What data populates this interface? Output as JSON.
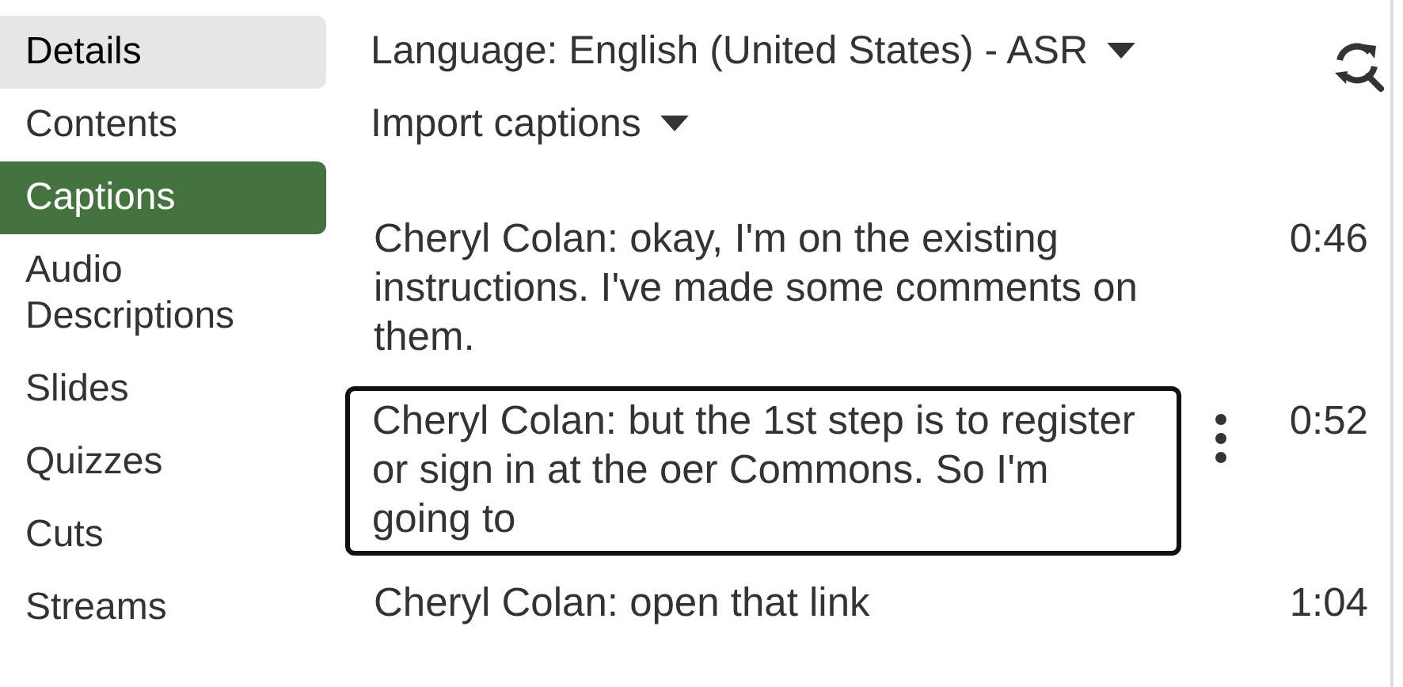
{
  "sidebar": {
    "items": [
      {
        "label": "Details",
        "selected": false,
        "hovered": true
      },
      {
        "label": "Contents",
        "selected": false,
        "hovered": false
      },
      {
        "label": "Captions",
        "selected": true,
        "hovered": false
      },
      {
        "label": "Audio Descriptions",
        "selected": false,
        "hovered": false
      },
      {
        "label": "Slides",
        "selected": false,
        "hovered": false
      },
      {
        "label": "Quizzes",
        "selected": false,
        "hovered": false
      },
      {
        "label": "Cuts",
        "selected": false,
        "hovered": false
      },
      {
        "label": "Streams",
        "selected": false,
        "hovered": false
      }
    ]
  },
  "language_dropdown": {
    "label": "Language: English (United States) - ASR"
  },
  "import_dropdown": {
    "label": "Import captions"
  },
  "captions": [
    {
      "text": "Cheryl Colan: okay, I'm on the existing instructions. I've made some comments on them.",
      "time": "0:46",
      "selected": false
    },
    {
      "text": "Cheryl Colan: but the 1st step is to register or sign in at the oer Commons. So I'm going to",
      "time": "0:52",
      "selected": true
    },
    {
      "text": "Cheryl Colan: open that link",
      "time": "1:04",
      "selected": false
    }
  ]
}
